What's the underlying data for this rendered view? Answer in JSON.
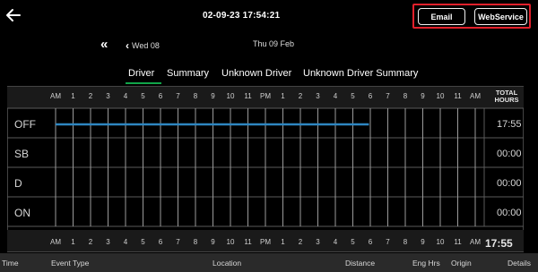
{
  "header": {
    "datetime": "02-09-23 17:54:21",
    "email_label": "Email",
    "webservice_label": "WebService"
  },
  "date_nav": {
    "prev_day_label": "Wed 08",
    "current_day_label": "Thu 09 Feb"
  },
  "tabs": [
    "Driver",
    "Summary",
    "Unknown Driver",
    "Unknown Driver Summary"
  ],
  "selected_tab": "Driver",
  "log": {
    "hour_labels": [
      "AM",
      "1",
      "2",
      "3",
      "4",
      "5",
      "6",
      "7",
      "8",
      "9",
      "10",
      "11",
      "PM",
      "1",
      "2",
      "3",
      "4",
      "5",
      "6",
      "7",
      "8",
      "9",
      "10",
      "11",
      "AM"
    ],
    "total_header_line1": "TOTAL",
    "total_header_line2": "HOURS",
    "rows": [
      {
        "label": "OFF",
        "total": "17:55"
      },
      {
        "label": "SB",
        "total": "00:00"
      },
      {
        "label": "D",
        "total": "00:00"
      },
      {
        "label": "ON",
        "total": "00:00"
      }
    ],
    "grand_total": "17:55",
    "status_segments": [
      {
        "status": "OFF",
        "start_hour": 0,
        "end_hour": 17.92
      }
    ],
    "line_color": "#2e86c1"
  },
  "footer": {
    "columns": [
      "Time",
      "Event Type",
      "Location",
      "Distance",
      "Eng Hrs",
      "Origin",
      "Details"
    ]
  }
}
